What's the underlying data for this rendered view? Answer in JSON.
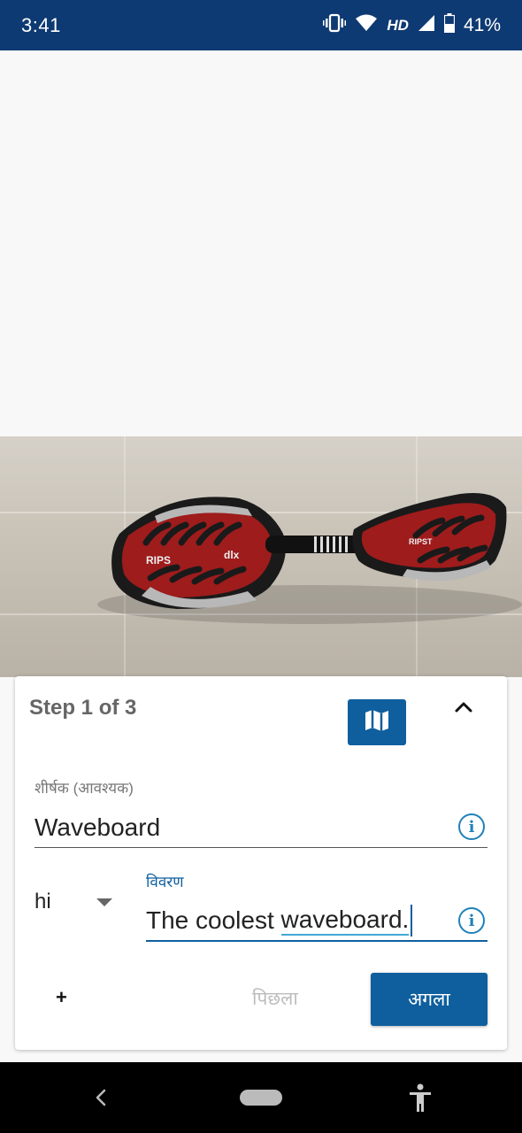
{
  "status_bar": {
    "time": "3:41",
    "network_label": "HD",
    "battery": "41%",
    "icons": [
      "vibrate-icon",
      "wifi-icon",
      "signal-icon",
      "battery-icon"
    ]
  },
  "photo": {
    "subject": "waveboard-photo",
    "board_text_left": "RIPS",
    "board_text_model": "dlx",
    "board_text_right": "RIPST"
  },
  "card": {
    "step_title": "Step 1 of 3",
    "map_button_icon": "map-icon",
    "collapse_icon": "chevron-up-icon",
    "title_label": "शीर्षक (आवश्यक)",
    "title_value": "Waveboard",
    "language_value": "hi",
    "description_label": "विवरण",
    "description_value_prefix": "The coolest ",
    "description_value_underlined": "waveboard.",
    "add_label": "+",
    "previous_label": "पिछला",
    "next_label": "अगला"
  },
  "nav_bar": {
    "icons": [
      "back-icon",
      "home-pill-icon",
      "accessibility-icon"
    ]
  },
  "colors": {
    "status_bar": "#0e3a73",
    "primary": "#0f5f9e",
    "info": "#1f82b8"
  }
}
